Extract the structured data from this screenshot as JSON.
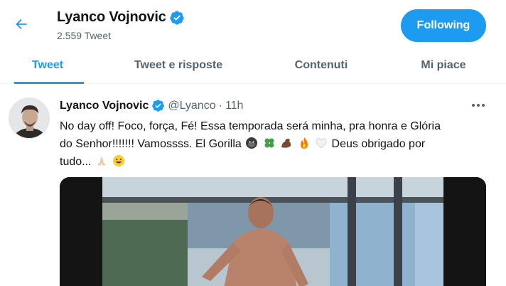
{
  "header": {
    "name": "Lyanco Vojnovic",
    "tweet_count": "2.559 Tweet",
    "follow_label": "Following"
  },
  "tabs": [
    {
      "label": "Tweet",
      "active": true
    },
    {
      "label": "Tweet e risposte",
      "active": false
    },
    {
      "label": "Contenuti",
      "active": false
    },
    {
      "label": "Mi piace",
      "active": false
    }
  ],
  "tweet": {
    "author": "Lyanco Vojnovic",
    "handle": "@Lyanco",
    "separator": "·",
    "time": "11h",
    "text_line1": "No day off! Foco, força, Fé! Essa temporada será minha, pra honra e Glória",
    "text_line2_a": "do Senhor!!!!!!! Vamossss. El Gorilla",
    "text_line2_b": "Deus obrigado por",
    "text_line3": "tudo...",
    "emojis_line2": [
      "gorilla-emoji",
      "clover-emoji",
      "flexed-biceps-emoji",
      "fire-emoji",
      "white-heart-emoji"
    ],
    "emojis_line3": [
      "folded-hands-emoji",
      "grinning-face-emoji"
    ]
  },
  "colors": {
    "accent": "#1d9bf0",
    "text": "#0f1419",
    "secondary_text": "#536471"
  },
  "icons": {
    "back": "arrow-left-icon",
    "verified": "verified-badge-icon",
    "more": "more-horizontal-icon"
  }
}
